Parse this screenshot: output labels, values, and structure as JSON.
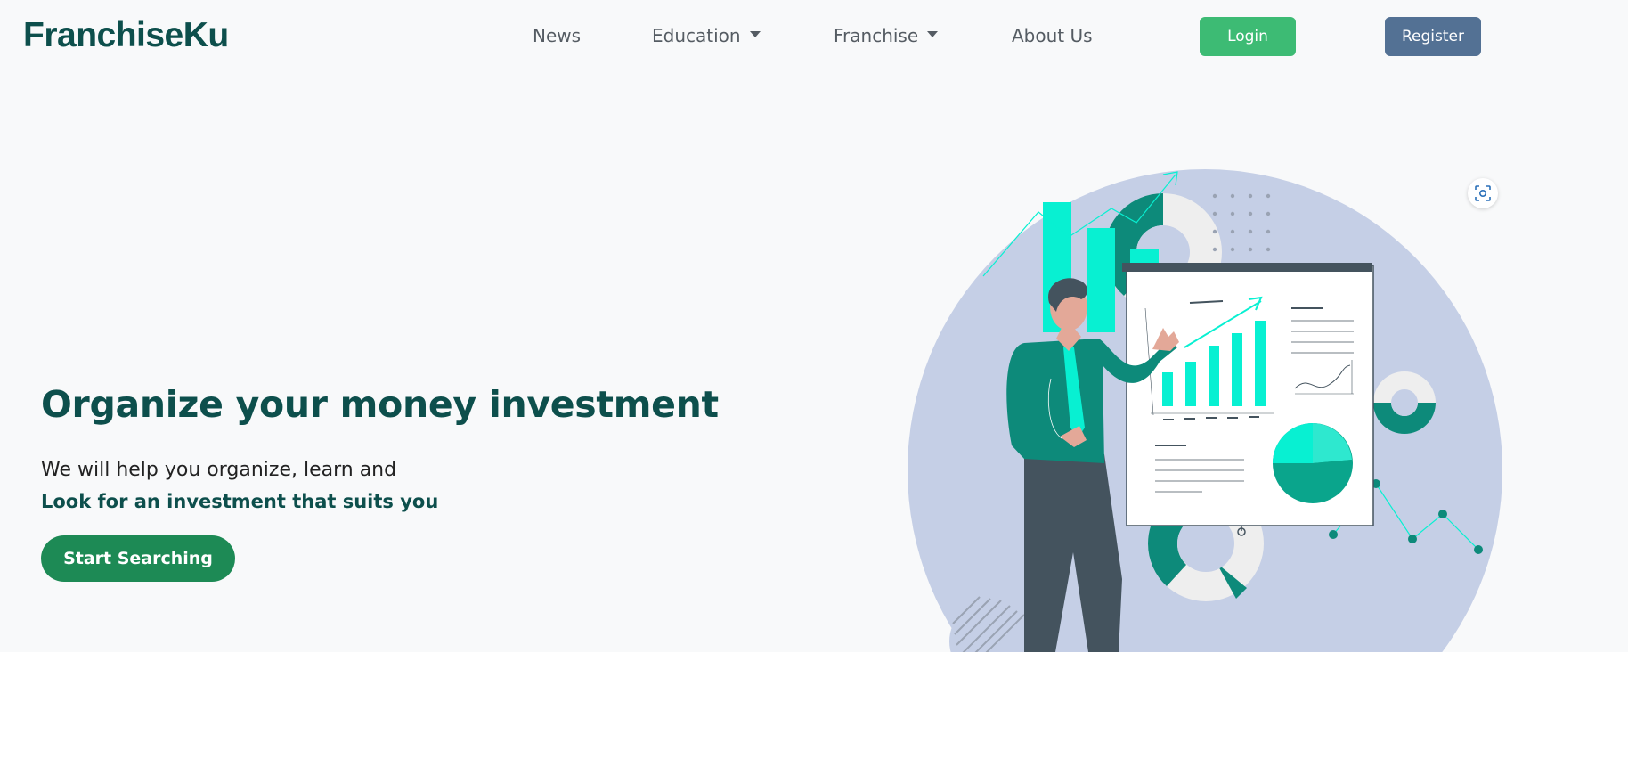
{
  "navbar": {
    "brand": "FranchiseKu",
    "links": [
      {
        "label": "News"
      },
      {
        "label": "Education"
      },
      {
        "label": "Franchise"
      },
      {
        "label": "About Us"
      }
    ],
    "login_label": "Login",
    "register_label": "Register"
  },
  "hero": {
    "title": "Organize your money investment",
    "subtitle": "We will help you organize, learn and",
    "subtitle_bold": "Look for an investment that suits you",
    "cta_label": "Start Searching"
  },
  "icons": {
    "scan": "scan-icon",
    "dropdown": "caret-down-icon"
  },
  "colors": {
    "brand": "#0d4f4c",
    "login": "#3dbb74",
    "register": "#537194",
    "cta": "#1d8a55",
    "accent": "#08f0d2",
    "teal": "#0d8a7a",
    "blob": "#c5cfe6"
  }
}
